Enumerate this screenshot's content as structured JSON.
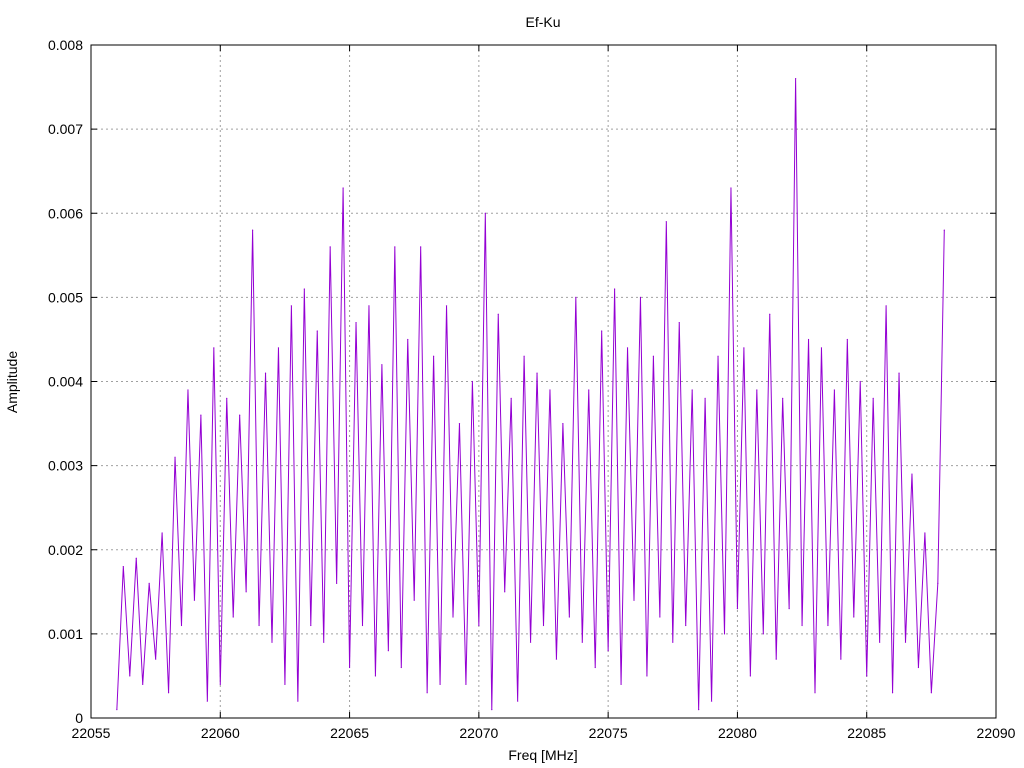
{
  "chart_data": {
    "type": "line",
    "title": "Ef-Ku",
    "xlabel": "Freq [MHz]",
    "ylabel": "Amplitude",
    "xlim": [
      22055,
      22090
    ],
    "ylim": [
      0,
      0.008
    ],
    "grid": true,
    "color": "#9400d3",
    "x_ticks": [
      "22055",
      "22060",
      "22065",
      "22070",
      "22075",
      "22080",
      "22085",
      "22090"
    ],
    "x_tick_values": [
      22055,
      22060,
      22065,
      22070,
      22075,
      22080,
      22085,
      22090
    ],
    "y_ticks": [
      "0",
      "0.001",
      "0.002",
      "0.003",
      "0.004",
      "0.005",
      "0.006",
      "0.007",
      "0.008"
    ],
    "y_tick_values": [
      0,
      0.001,
      0.002,
      0.003,
      0.004,
      0.005,
      0.006,
      0.007,
      0.008
    ],
    "series": [
      {
        "name": "Ef-Ku",
        "x_start": 22056,
        "x_step": 0.25,
        "values": [
          0.0001,
          0.0018,
          0.0005,
          0.0019,
          0.0004,
          0.0016,
          0.0007,
          0.0022,
          0.0003,
          0.0031,
          0.0011,
          0.0039,
          0.0014,
          0.0036,
          0.0002,
          0.0044,
          0.0004,
          0.0038,
          0.0012,
          0.0036,
          0.0015,
          0.0058,
          0.0011,
          0.0041,
          0.0009,
          0.0044,
          0.0004,
          0.0049,
          0.0002,
          0.0051,
          0.0011,
          0.0046,
          0.0009,
          0.0056,
          0.0016,
          0.0063,
          0.0006,
          0.0047,
          0.0011,
          0.0049,
          0.0005,
          0.0042,
          0.0008,
          0.0056,
          0.0006,
          0.0045,
          0.0014,
          0.0056,
          0.0003,
          0.0043,
          0.0004,
          0.0049,
          0.0012,
          0.0035,
          0.0004,
          0.004,
          0.0011,
          0.006,
          0.0001,
          0.0048,
          0.0015,
          0.0038,
          0.0002,
          0.0043,
          0.0009,
          0.0041,
          0.0011,
          0.0039,
          0.0007,
          0.0035,
          0.0012,
          0.005,
          0.0009,
          0.0039,
          0.0006,
          0.0046,
          0.0008,
          0.0051,
          0.0004,
          0.0044,
          0.0014,
          0.005,
          0.0005,
          0.0043,
          0.0012,
          0.0059,
          0.0009,
          0.0047,
          0.0011,
          0.0039,
          0.0001,
          0.0038,
          0.0002,
          0.0043,
          0.001,
          0.0063,
          0.0013,
          0.0044,
          0.0005,
          0.0039,
          0.001,
          0.0048,
          0.0007,
          0.0038,
          0.0013,
          0.0076,
          0.0011,
          0.0045,
          0.0003,
          0.0044,
          0.0011,
          0.0039,
          0.0007,
          0.0045,
          0.0012,
          0.004,
          0.0005,
          0.0038,
          0.0009,
          0.0049,
          0.0003,
          0.0041,
          0.0009,
          0.0029,
          0.0006,
          0.0022,
          0.0003,
          0.0016,
          0.0058
        ]
      }
    ]
  }
}
